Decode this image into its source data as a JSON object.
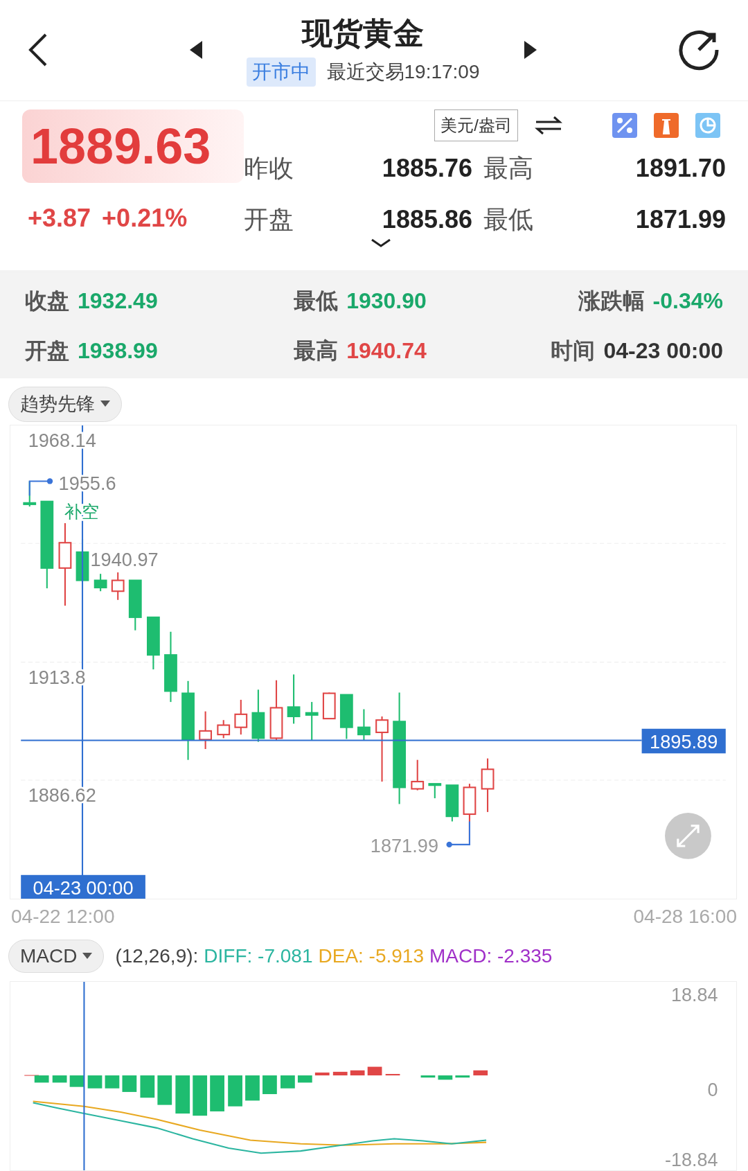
{
  "header": {
    "title": "现货黄金",
    "status": "开市中",
    "last_trade": "最近交易19:17:09"
  },
  "quote": {
    "price": "1889.63",
    "change": "+3.87",
    "change_pct": "+0.21%",
    "unit": "美元/盎司",
    "stats": [
      {
        "label": "昨收",
        "value": "1885.76"
      },
      {
        "label": "最高",
        "value": "1891.70"
      },
      {
        "label": "开盘",
        "value": "1885.86"
      },
      {
        "label": "最低",
        "value": "1871.99"
      }
    ]
  },
  "candle_info": [
    {
      "label": "收盘",
      "value": "1932.49",
      "color": "#1aa86a"
    },
    {
      "label": "最低",
      "value": "1930.90",
      "color": "#1aa86a"
    },
    {
      "label": "涨跌幅",
      "value": "-0.34%",
      "color": "#1aa86a"
    },
    {
      "label": "开盘",
      "value": "1938.99",
      "color": "#1aa86a"
    },
    {
      "label": "最高",
      "value": "1940.74",
      "color": "#e04646"
    },
    {
      "label": "时间",
      "value": "04-23 00:00",
      "color": "#333333"
    }
  ],
  "indicator": {
    "label": "趋势先锋"
  },
  "price_chart": {
    "y_labels": [
      "1968.14",
      "1940.97",
      "1913.8",
      "1886.62"
    ],
    "high_mark": "1955.6",
    "signal": "补空",
    "low_mark": "1871.99",
    "current_price": "1895.89",
    "crosshair_time": "04-23 00:00",
    "x_labels": [
      "04-22 12:00",
      "04-28 16:00"
    ]
  },
  "macd": {
    "selector": "MACD",
    "params": "(12,26,9):",
    "values": [
      {
        "label": "DIFF: -7.081",
        "color": "#2bb5a0"
      },
      {
        "label": "DEA: -5.913",
        "color": "#e8a820"
      },
      {
        "label": "MACD: -2.335",
        "color": "#a030c8"
      }
    ],
    "y_labels": [
      "18.84",
      "0",
      "-18.84"
    ]
  }
}
